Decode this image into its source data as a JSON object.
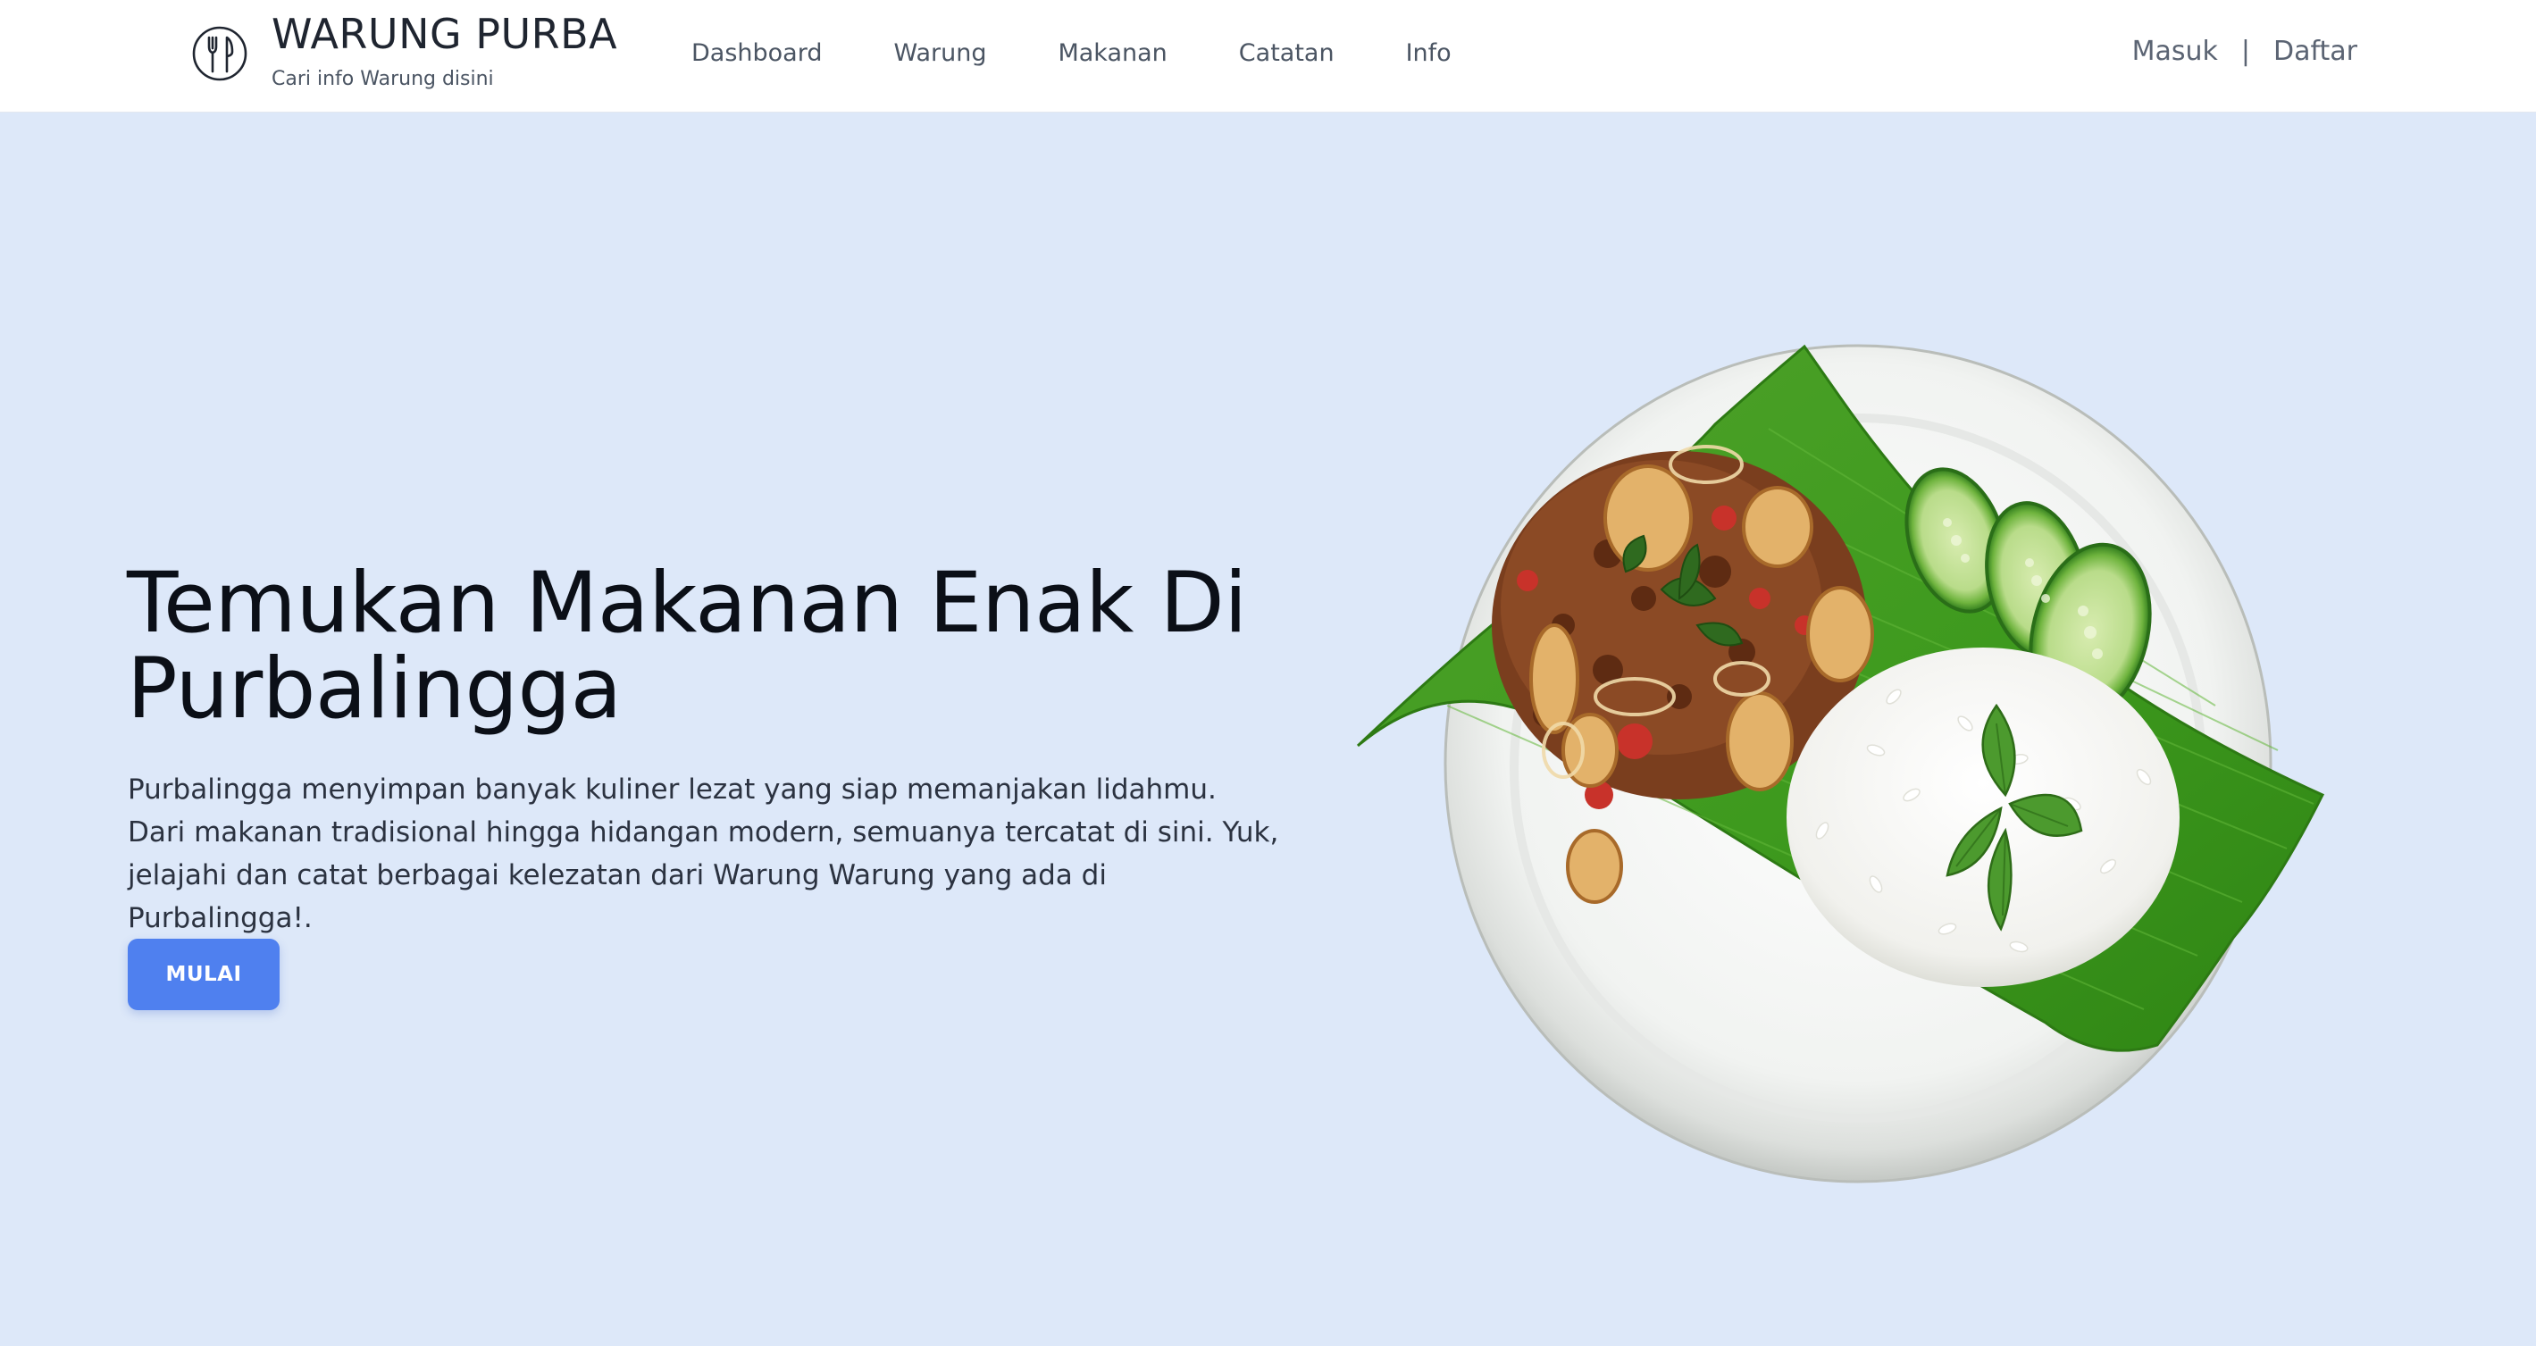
{
  "brand": {
    "title": "WARUNG PURBA",
    "subtitle": "Cari info Warung disini",
    "logo_icon": "fork-knife-icon"
  },
  "nav": {
    "items": [
      "Dashboard",
      "Warung",
      "Makanan",
      "Catatan",
      "Info"
    ]
  },
  "auth": {
    "login": "Masuk",
    "separator": "|",
    "register": "Daftar"
  },
  "hero": {
    "title": "Temukan Makanan Enak Di Purbalingga",
    "description": "Purbalingga menyimpan banyak kuliner lezat yang siap memanjakan lidahmu. Dari makanan tradisional hingga hidangan modern, semuanya tercatat di sini. Yuk, jelajahi dan catat berbagai kelezatan dari Warung Warung yang ada di Purbalingga!.",
    "cta_label": "MULAI",
    "image_icon": "food-plate-illustration"
  },
  "colors": {
    "background": "#dde8f9",
    "navbar": "#ffffff",
    "accent": "#4f80ef",
    "title": "#0b0f17",
    "text": "#2b3240",
    "nav_text": "#4b5563"
  }
}
